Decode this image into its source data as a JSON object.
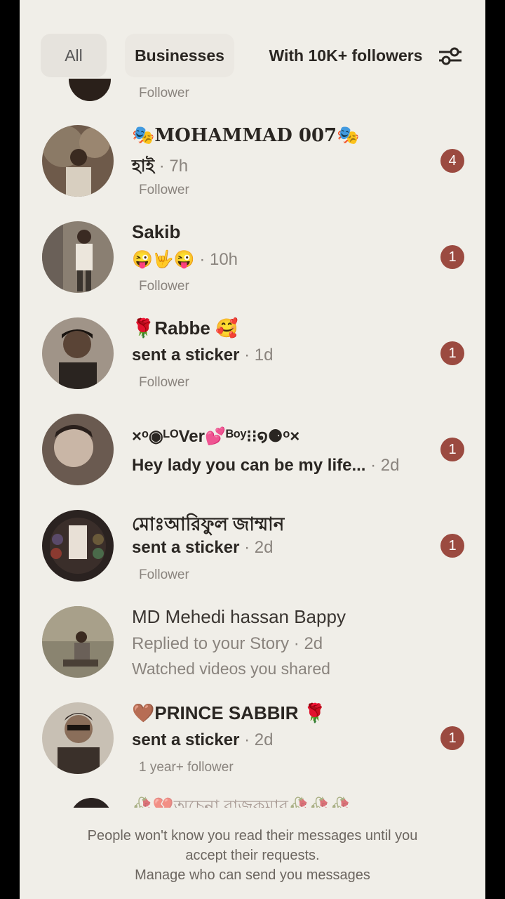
{
  "tabs": [
    {
      "label": "All"
    },
    {
      "label": "Businesses"
    },
    {
      "label": "With 10K+ followers"
    }
  ],
  "icons": {
    "filter": "sliders-icon"
  },
  "partial_top": {
    "sub": "Follower"
  },
  "conversations": [
    {
      "name": "🎭MOHAMMAD 007🎭",
      "message": "হাই",
      "time": "· 7h",
      "sub": "Follower",
      "badge": "4"
    },
    {
      "name": "Sakib",
      "message": "😜🤟😜",
      "time": "· 10h",
      "sub": "Follower",
      "badge": "1"
    },
    {
      "name": "🌹Rabbe 🥰",
      "message": "sent a sticker",
      "time": "· 1d",
      "sub": "Follower",
      "badge": "1"
    },
    {
      "name": "×ᵒ◉ᴸᴼVer💕ᴮᵒʸ⁝⁝໑⚈ᵒ×",
      "message": "Hey lady you can be my life...",
      "time": "· 2d",
      "badge": "1"
    },
    {
      "name": "মোঃআরিফুল জাম্মান",
      "message": "sent a sticker",
      "time": "· 2d",
      "sub": "Follower",
      "badge": "1"
    },
    {
      "name": "MD Mehedi hassan Bappy",
      "message": "Replied to your Story · 2d",
      "sub": "Watched videos you shared"
    },
    {
      "name": "🤎PRINCE SABBIR 🌹",
      "message": "sent a sticker",
      "time": "· 2d",
      "sub": "1 year+ follower",
      "badge": "1"
    }
  ],
  "partial_bottom": {
    "name": "🥀💔অচেনা রাজকুমার🥀🥀🥀"
  },
  "footer": {
    "line1": "People won't know you read their messages until you",
    "line2": "accept their requests.",
    "line3": "Manage who can send you messages"
  },
  "colors": {
    "badge": "#9b4a40",
    "background": "#f0eee8"
  }
}
